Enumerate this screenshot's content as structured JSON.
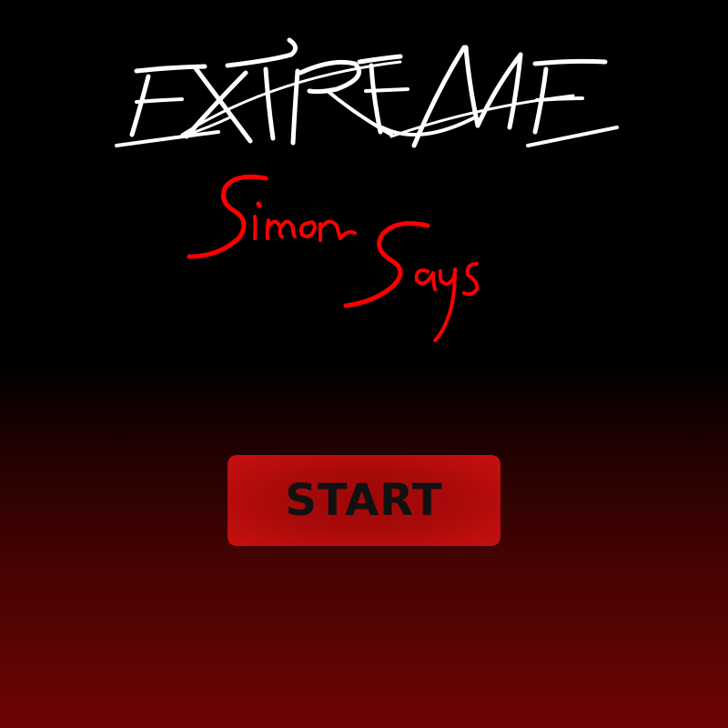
{
  "title": {
    "main": "EXTREME",
    "sub_line1": "Simon",
    "sub_line2": "Says"
  },
  "start_button": {
    "label": "START"
  },
  "colors": {
    "title_main": "#ffffff",
    "title_sub": "#ff0000",
    "button_fill": "#b00b0b",
    "button_text": "#111111",
    "background_top": "#000000",
    "background_bottom": "#6e0404"
  }
}
